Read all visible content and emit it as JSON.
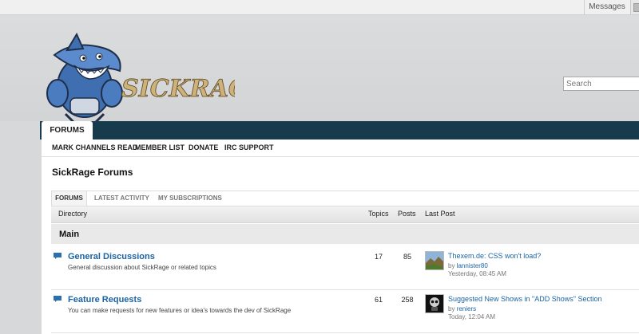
{
  "topbar": {
    "messages_label": "Messages"
  },
  "header": {
    "logo_text": "SICKRAGE",
    "search_placeholder": "Search"
  },
  "nav": {
    "active_tab": "FORUMS"
  },
  "subnav": {
    "items": [
      "MARK CHANNELS READ",
      "MEMBER LIST",
      "DONATE",
      "IRC SUPPORT"
    ]
  },
  "page": {
    "title": "SickRage Forums"
  },
  "tabs": [
    "FORUMS",
    "LATEST ACTIVITY",
    "MY SUBSCRIPTIONS"
  ],
  "table": {
    "columns": {
      "directory": "Directory",
      "topics": "Topics",
      "posts": "Posts",
      "last_post": "Last Post"
    },
    "category": "Main",
    "forums": [
      {
        "name": "General Discussions",
        "description": "General discussion about SickRage or related topics",
        "topics": "17",
        "posts": "85",
        "last_post_title": "Thexem.de: CSS won't load?",
        "last_post_by_label": "by",
        "last_post_user": "lannister80",
        "last_post_time": "Yesterday, 08:45 AM"
      },
      {
        "name": "Feature Requests",
        "description": "You can make requests for new features or idea's towards the dev of SickRage",
        "topics": "61",
        "posts": "258",
        "last_post_title": "Suggested New Shows in \"ADD Shows\" Section",
        "last_post_by_label": "by",
        "last_post_user": "reniers",
        "last_post_time": "Today, 12:04 AM"
      }
    ]
  },
  "colors": {
    "nav_bar": "#183a4d",
    "link": "#1c63a3",
    "header_bg": "#d6d8da"
  }
}
